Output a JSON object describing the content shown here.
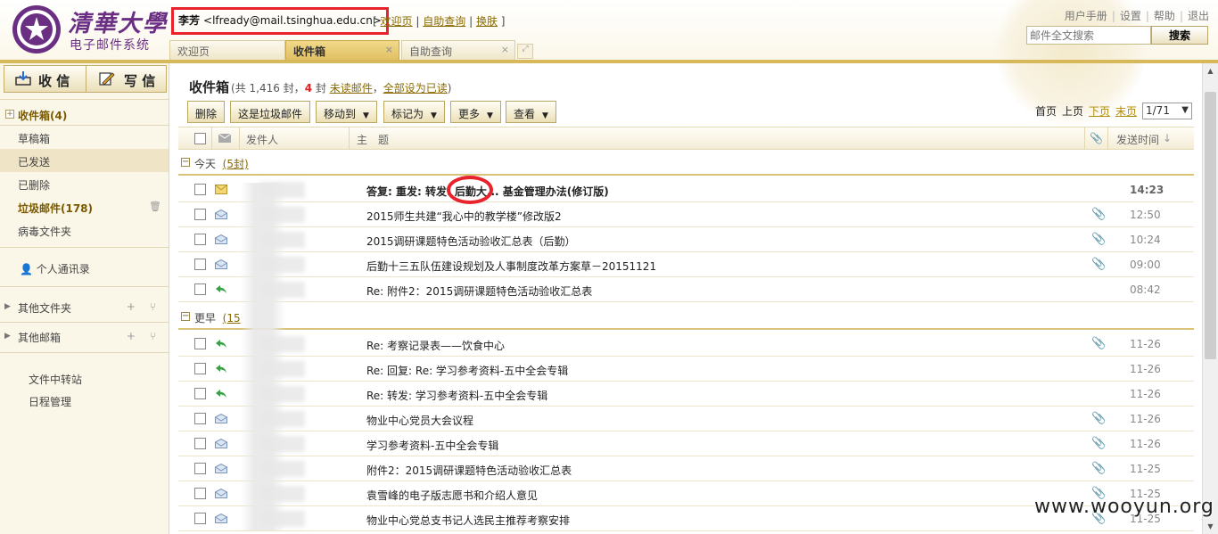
{
  "brand": {
    "title": "清華大學",
    "subtitle": "电子邮件系统"
  },
  "user": {
    "name": "李芳",
    "email": "<lfready@mail.tsinghua.edu.cn>",
    "open_bracket": "[",
    "close_bracket": "]",
    "sep": "|",
    "links": [
      "欢迎页",
      "自助查询",
      "换肤"
    ]
  },
  "top_links": [
    "用户手册",
    "设置",
    "帮助",
    "退出"
  ],
  "search": {
    "placeholder": "邮件全文搜索",
    "button": "搜索"
  },
  "tabs": [
    {
      "label": "欢迎页"
    },
    {
      "label": "收件箱",
      "close": "×"
    },
    {
      "label": "自助查询",
      "close": "×"
    }
  ],
  "sidebar": {
    "receive": "收 信",
    "compose": "写 信",
    "inbox": "收件箱(4)",
    "items": [
      "草稿箱",
      "已发送",
      "已删除",
      "垃圾邮件(178)",
      "病毒文件夹"
    ],
    "contacts": "个人通讯录",
    "other_folders": "其他文件夹",
    "other_mailboxes": "其他邮箱",
    "plus_minus": "+ ⑂",
    "transfer": "文件中转站",
    "calendar": "日程管理"
  },
  "main": {
    "title": "收件箱",
    "summary_prefix": "(共 1,416 封，",
    "unread_count": "4",
    "summary_mid": " 封 ",
    "unread_link": "未读邮件",
    "comma": "，",
    "mark_all": "全部设为已读",
    "summary_suffix": ")"
  },
  "toolbar": {
    "buttons": [
      "删除",
      "这是垃圾邮件",
      "移动到",
      "标记为",
      "更多",
      "查看"
    ],
    "caret": "▼"
  },
  "pager": {
    "first": "首页",
    "prev": "上页",
    "next": "下页",
    "last": "末页",
    "current": "1/71",
    "dd": "▼"
  },
  "columns": {
    "sender": "发件人",
    "subject": "主　题",
    "date": "发送时间"
  },
  "groups": {
    "today": "今天",
    "today_count": "(5封)",
    "earlier": "更早",
    "earlier_count": "(15"
  },
  "messages_today": [
    {
      "subject": "答复: 重发: 转发: 后勤大... 基金管理办法(修订版)",
      "time": "14:23",
      "unread": true,
      "attach": false,
      "icon": "envelope"
    },
    {
      "subject": "2015师生共建“我心中的教学楼”修改版2",
      "time": "12:50",
      "attach": true,
      "icon": "read"
    },
    {
      "subject": "2015调研课题特色活动验收汇总表（后勤）",
      "time": "10:24",
      "attach": true,
      "icon": "read"
    },
    {
      "subject": "后勤十三五队伍建设规划及人事制度改革方案草－20151121",
      "time": "09:00",
      "attach": true,
      "icon": "read"
    },
    {
      "subject": "Re: 附件2：2015调研课题特色活动验收汇总表",
      "time": "08:42",
      "attach": false,
      "icon": "reply"
    }
  ],
  "messages_earlier": [
    {
      "subject": "Re: 考察记录表——饮食中心",
      "time": "11-26",
      "attach": true,
      "icon": "reply"
    },
    {
      "subject": "Re: 回复: Re: 学习参考资料-五中全会专辑",
      "time": "11-26",
      "attach": false,
      "icon": "reply"
    },
    {
      "subject": "Re: 转发: 学习参考资料-五中全会专辑",
      "time": "11-26",
      "attach": false,
      "icon": "reply"
    },
    {
      "subject": "物业中心党员大会议程",
      "time": "11-26",
      "attach": true,
      "icon": "read"
    },
    {
      "subject": "学习参考资料-五中全会专辑",
      "time": "11-26",
      "attach": true,
      "icon": "read"
    },
    {
      "subject": "附件2：2015调研课题特色活动验收汇总表",
      "time": "11-25",
      "attach": true,
      "icon": "read"
    },
    {
      "subject": "袁雪峰的电子版志愿书和介绍人意见",
      "time": "11-25",
      "attach": true,
      "icon": "read"
    },
    {
      "subject": "物业中心党总支书记人选民主推荐考察安排",
      "time": "11-25",
      "attach": true,
      "icon": "read"
    }
  ],
  "watermark": "www.wooyun.org",
  "icons": [
    "logo-seal-icon",
    "receive-icon",
    "compose-icon",
    "envelope-icon",
    "read-icon",
    "reply-icon",
    "attachment-icon",
    "contacts-icon",
    "trash-icon"
  ],
  "colors": {
    "accent": "#d7b85b",
    "brand": "#6a2e83",
    "highlight_red": "#e8232c",
    "link": "#8a6a00"
  }
}
